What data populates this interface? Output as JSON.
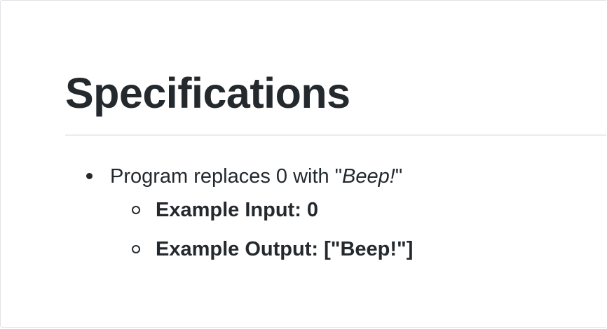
{
  "section": {
    "heading": "Specifications"
  },
  "spec_list": [
    {
      "prefix": "Program replaces 0 with \"",
      "emphasis": "Beep!",
      "suffix": "\"",
      "sub_items": [
        {
          "label": "Example Input: 0"
        },
        {
          "label": "Example Output: [\"Beep!\"]"
        }
      ]
    }
  ]
}
